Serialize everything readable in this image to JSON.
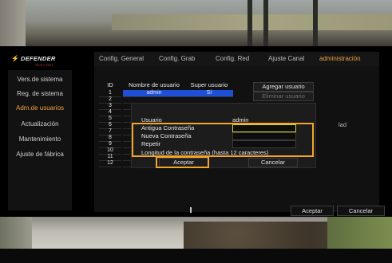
{
  "brand": {
    "name": "DEFENDER",
    "tagline": "SENTINEL"
  },
  "tabs": [
    {
      "label": "Config. General",
      "active": false
    },
    {
      "label": "Config. Grab",
      "active": false
    },
    {
      "label": "Config. Red",
      "active": false
    },
    {
      "label": "Ajuste Canal",
      "active": false
    },
    {
      "label": "administración",
      "active": true
    }
  ],
  "sidebar": {
    "items": [
      {
        "label": "Vers.de sistema",
        "active": false
      },
      {
        "label": "Reg. de sistema",
        "active": false
      },
      {
        "label": "Adm.de usuarios",
        "active": true
      },
      {
        "label": "Actualización",
        "active": false
      },
      {
        "label": "Mantenimiento",
        "active": false
      },
      {
        "label": "Ajuste de fábrica",
        "active": false
      }
    ]
  },
  "users_table": {
    "headers": [
      "ID",
      "Nombre de usuario",
      "Super usuario"
    ],
    "rows": [
      {
        "id": "1",
        "name": "admin",
        "super": "Sí",
        "selected": true
      },
      {
        "id": "2",
        "name": "",
        "super": "",
        "selected": false
      },
      {
        "id": "3",
        "name": "",
        "super": "",
        "selected": false
      },
      {
        "id": "4",
        "name": "",
        "super": "",
        "selected": false
      },
      {
        "id": "5",
        "name": "",
        "super": "",
        "selected": false
      },
      {
        "id": "6",
        "name": "",
        "super": "",
        "selected": false
      },
      {
        "id": "7",
        "name": "",
        "super": "",
        "selected": false
      },
      {
        "id": "8",
        "name": "",
        "super": "",
        "selected": false
      },
      {
        "id": "9",
        "name": "",
        "super": "",
        "selected": false
      },
      {
        "id": "10",
        "name": "",
        "super": "",
        "selected": false
      },
      {
        "id": "11",
        "name": "",
        "super": "",
        "selected": false
      },
      {
        "id": "12",
        "name": "",
        "super": "",
        "selected": false
      }
    ]
  },
  "actions": {
    "add_user": "Agregar usuario",
    "delete_user": "Eliminar usuario",
    "clipped_text": "lad"
  },
  "dialog": {
    "user_label": "Usuario",
    "user_value": "admin",
    "old_password_label": "Antigua Contraseña",
    "new_password_label": "Nueva Contraseña",
    "repeat_label": "Repetir",
    "length_note": "Longitud de la contraseña (hasta 12 caracteres)",
    "accept": "Aceptar",
    "cancel": "Cancelar"
  },
  "bottom": {
    "accept": "Aceptar",
    "cancel": "Cancelar"
  },
  "colors": {
    "accent": "#f0a040",
    "highlight_box": "#f5a52a",
    "selected_row": "#1f4fd6",
    "field_focus": "#d6d12a"
  }
}
